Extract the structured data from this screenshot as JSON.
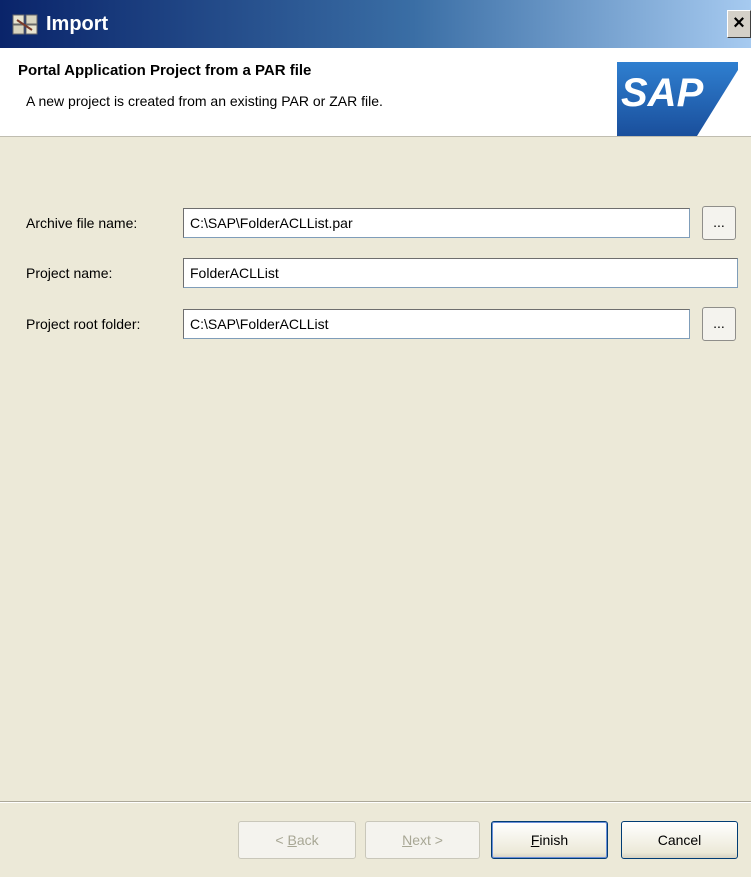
{
  "window": {
    "title": "Import",
    "close_glyph": "×"
  },
  "header": {
    "title": "Portal Application Project from a PAR file",
    "description": "A new project is created from an existing PAR or ZAR file.",
    "logo_text": "SAP",
    "brand_color": "#1f5aa6"
  },
  "form": {
    "archive": {
      "label": "Archive file name:",
      "value": "C:\\SAP\\FolderACLList.par",
      "browse_label": "..."
    },
    "project_name": {
      "label": "Project name:",
      "value": "FolderACLList"
    },
    "project_root": {
      "label": "Project root folder:",
      "value": "C:\\SAP\\FolderACLList",
      "browse_label": "..."
    }
  },
  "buttons": {
    "back": {
      "prefix": "< ",
      "mnemonic": "B",
      "rest": "ack"
    },
    "next": {
      "mnemonic": "N",
      "rest": "ext >"
    },
    "finish": {
      "mnemonic": "F",
      "rest": "inish"
    },
    "cancel": {
      "label": "Cancel"
    }
  },
  "icons": {
    "title_icon": "import-wizard-icon",
    "close": "close-icon",
    "logo": "sap-logo"
  }
}
